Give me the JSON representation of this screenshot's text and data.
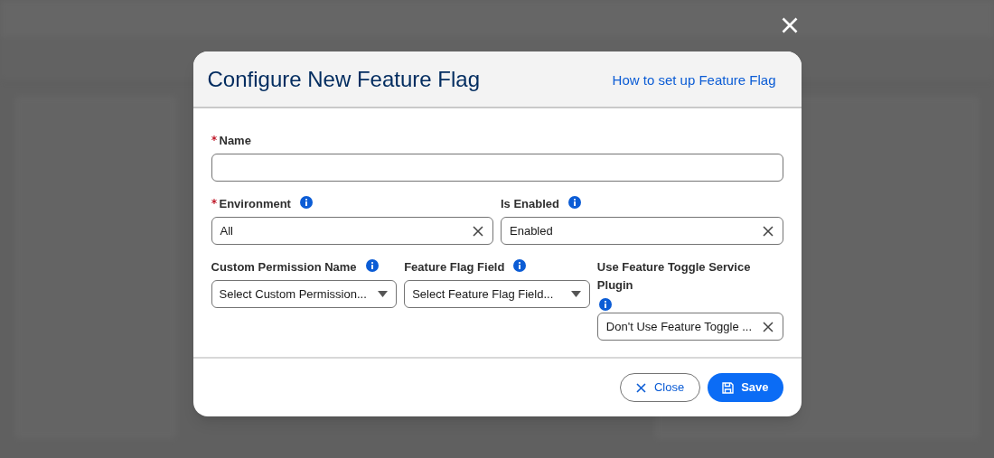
{
  "dialog": {
    "title": "Configure New Feature Flag",
    "help_link": "How to set up Feature Flag"
  },
  "field_rows": [
    [
      {
        "kind": "text",
        "label": "Name",
        "required": true,
        "info": false
      }
    ],
    [
      {
        "kind": "combobox",
        "label": "Environment",
        "required": true,
        "info": true,
        "value": "All"
      },
      {
        "kind": "combobox",
        "label": "Is Enabled",
        "required": false,
        "info": true,
        "value": "Enabled"
      }
    ],
    [
      {
        "kind": "select",
        "label": "Custom Permission Name",
        "required": false,
        "info": true,
        "placeholder": "Select Custom Permission..."
      },
      {
        "kind": "select",
        "label": "Feature Flag Field",
        "required": false,
        "info": true,
        "placeholder": "Select Feature Flag Field..."
      },
      {
        "kind": "combobox",
        "label": "Use Feature Toggle Service Plugin",
        "required": false,
        "info": true,
        "info_below": true,
        "value": "Don't Use Feature Toggle ..."
      }
    ]
  ],
  "buttons": [
    {
      "kind": "close",
      "label": "Close"
    },
    {
      "kind": "save",
      "label": "Save"
    }
  ]
}
